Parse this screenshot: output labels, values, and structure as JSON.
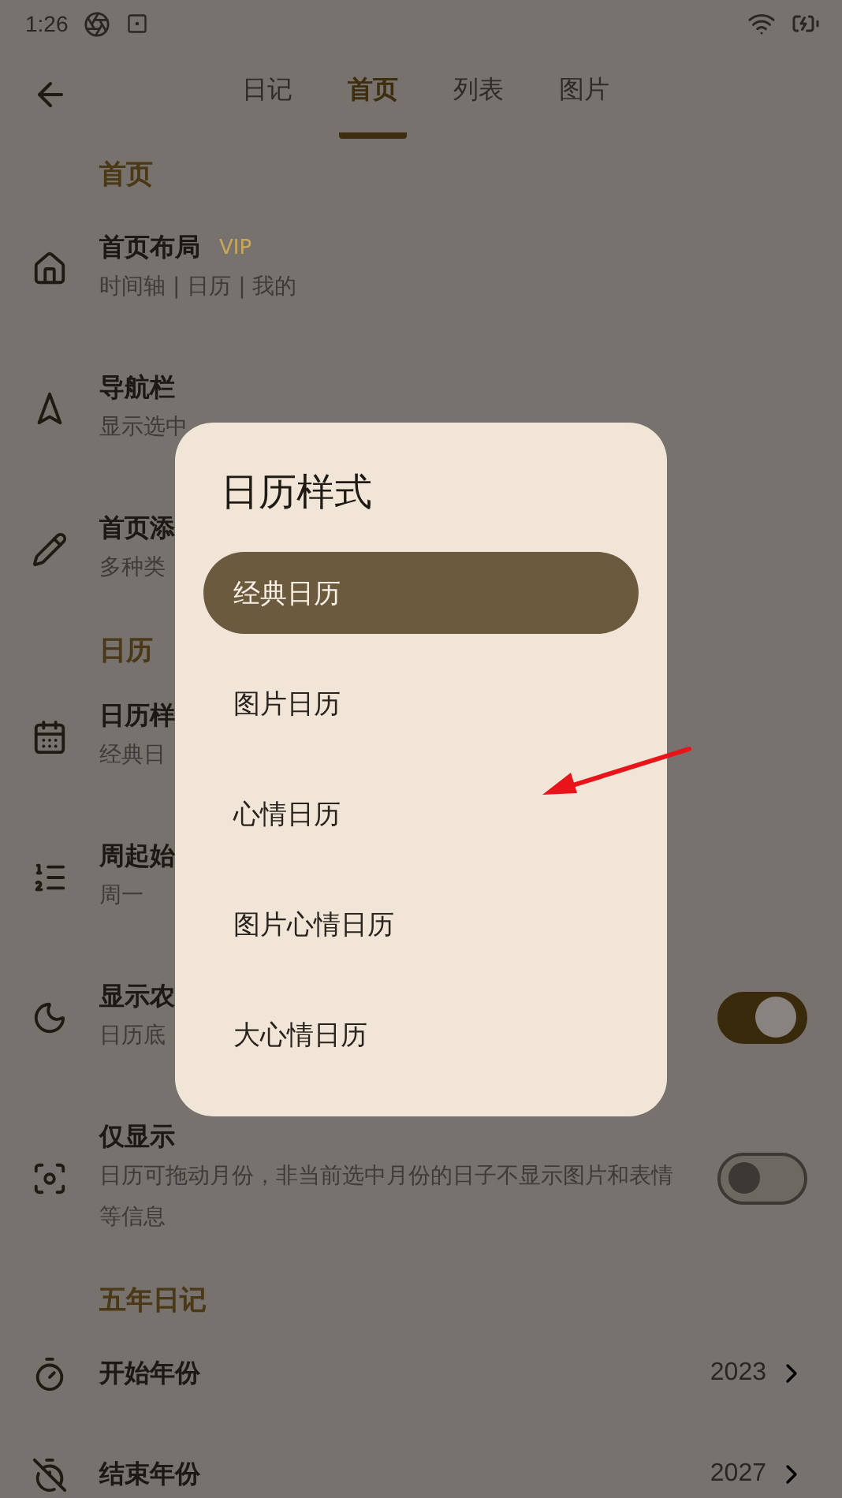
{
  "status_bar": {
    "time": "1:26"
  },
  "tabs": [
    {
      "label": "日记",
      "selected": false
    },
    {
      "label": "首页",
      "selected": true
    },
    {
      "label": "列表",
      "selected": false
    },
    {
      "label": "图片",
      "selected": false
    }
  ],
  "sections": [
    {
      "title": "首页",
      "items": [
        {
          "kind": "nav",
          "title": "首页布局",
          "badge": "VIP",
          "subtitle": "时间轴 | 日历 | 我的"
        },
        {
          "kind": "nav",
          "title": "导航栏",
          "subtitle": "显示选中"
        },
        {
          "kind": "nav",
          "title": "首页添",
          "subtitle": "多种类"
        }
      ]
    },
    {
      "title": "日历",
      "items": [
        {
          "kind": "nav",
          "title": "日历样",
          "subtitle": "经典日"
        },
        {
          "kind": "nav",
          "title": "周起始",
          "subtitle": "周一"
        },
        {
          "kind": "toggle",
          "title": "显示农",
          "subtitle": "日历底",
          "on": true
        },
        {
          "kind": "toggle",
          "title": "仅显示",
          "subtitle": "日历可拖动月份，非当前选中月份的日子不显示图片和表情等信息",
          "on": false
        }
      ]
    },
    {
      "title": "五年日记",
      "items": [
        {
          "kind": "value",
          "title": "开始年份",
          "value": "2023"
        },
        {
          "kind": "value",
          "title": "结束年份",
          "value": "2027"
        }
      ]
    }
  ],
  "dialog": {
    "title": "日历样式",
    "options": [
      {
        "label": "经典日历",
        "selected": true
      },
      {
        "label": "图片日历",
        "selected": false
      },
      {
        "label": "心情日历",
        "selected": false
      },
      {
        "label": "图片心情日历",
        "selected": false
      },
      {
        "label": "大心情日历",
        "selected": false
      }
    ]
  }
}
